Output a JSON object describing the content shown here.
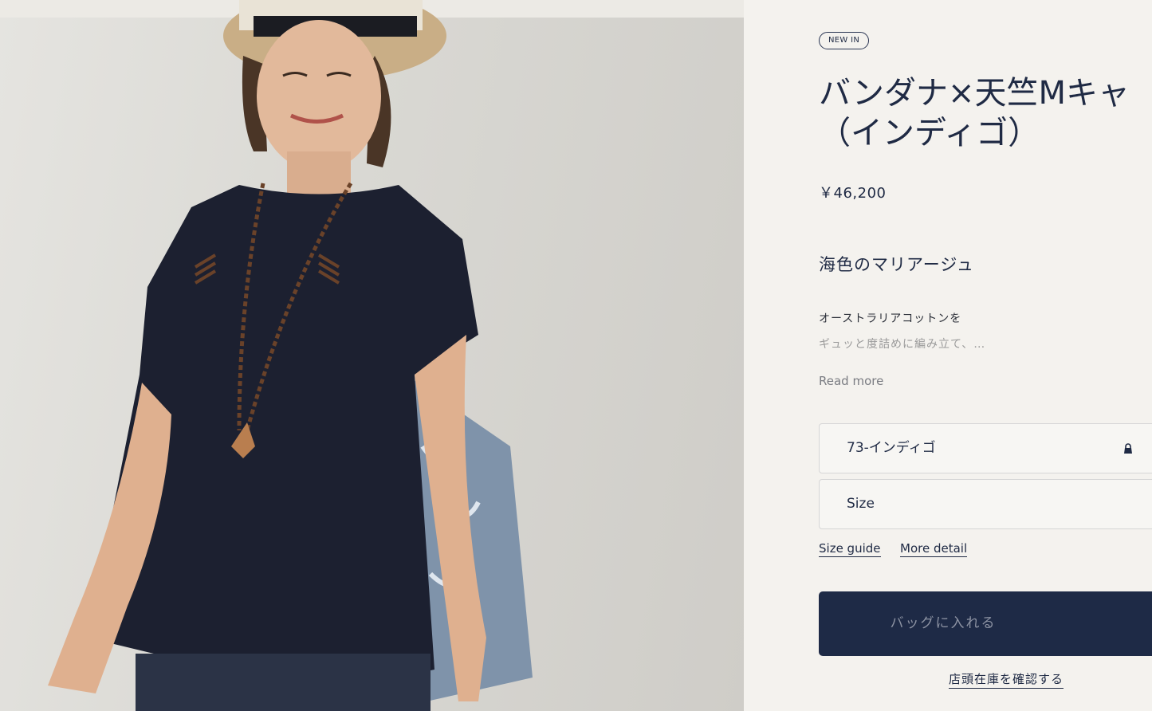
{
  "product": {
    "badge": "NEW IN",
    "title_line1": "バンダナ×天竺Mキャ",
    "title_line2": "（インディゴ）",
    "price": "￥46,200",
    "tagline": "海色のマリアージュ",
    "description_line1": "オーストラリアコットンを",
    "description_line2": "ギュッと度詰めに編み立て、…",
    "read_more": "Read more"
  },
  "options": {
    "color_value": "73-インディゴ",
    "size_placeholder": "Size"
  },
  "links": {
    "size_guide": "Size guide",
    "more_detail": "More detail"
  },
  "actions": {
    "add_to_bag": "バッグに入れる",
    "check_store_stock": "店頭在庫を確認する"
  },
  "colors": {
    "navy": "#1e2a46",
    "background": "#f4f2ee"
  }
}
